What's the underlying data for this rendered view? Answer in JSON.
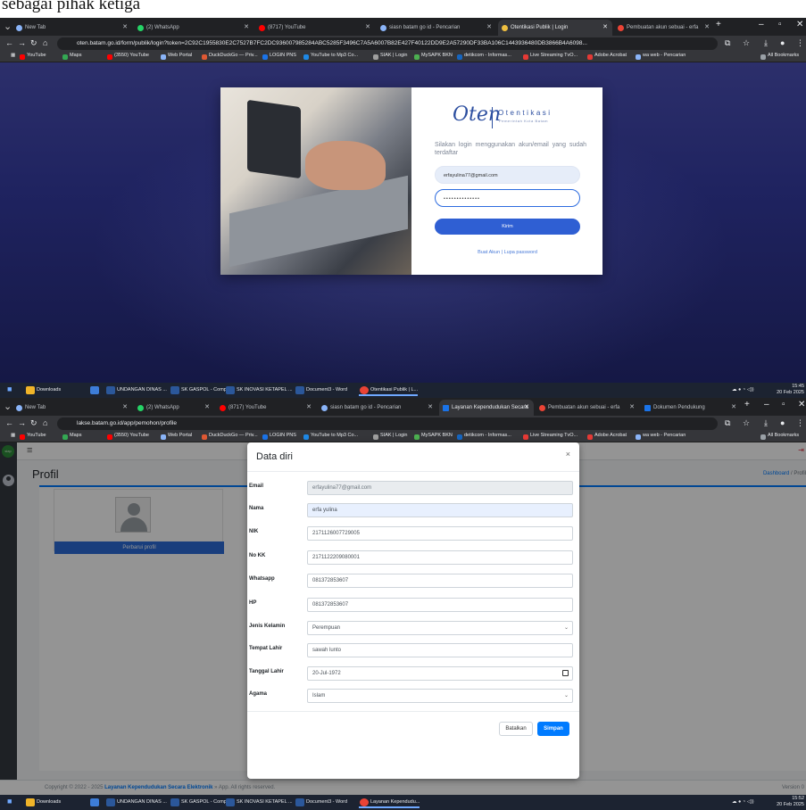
{
  "caption": "sebagai pihak ketiga",
  "shot1": {
    "tabs": [
      {
        "label": "New Tab",
        "color": "#8ab4f8"
      },
      {
        "label": "(2) WhatsApp",
        "color": "#25d366"
      },
      {
        "label": "(8717) YouTube",
        "color": "#ff0000"
      },
      {
        "label": "siasn batam go id - Pencarian",
        "color": "#8ab4f8"
      },
      {
        "label": "Otentikasi Publik | Login",
        "color": "#f0c040"
      },
      {
        "label": "Pembuatan akun sebuai - erfa",
        "color": "#ea4335"
      }
    ],
    "url": "oten.batam.go.id/form/publik/login?token=2C92C1955830E2C7527B7FC2DC936007985284ABC5285F3496C7A5A6007B82E427F40122DD9E2A57290DF33BA106C1443936480DB3866B4A6098...",
    "bookmarks": [
      {
        "label": "YouTube",
        "color": "#ff0000"
      },
      {
        "label": "Maps",
        "color": "#34a853"
      },
      {
        "label": "(3550) YouTube",
        "color": "#ff0000"
      },
      {
        "label": "Web Portal",
        "color": "#8ab4f8"
      },
      {
        "label": "DuckDuckGo — Priv...",
        "color": "#de5833"
      },
      {
        "label": "LOGIN PNS",
        "color": "#1a73e8"
      },
      {
        "label": "YouTube to Mp3 Co...",
        "color": "#1e88e5"
      },
      {
        "label": "SIAK | Login",
        "color": "#9e9e9e"
      },
      {
        "label": "MySAPK BKN",
        "color": "#4caf50"
      },
      {
        "label": "detikcom - Informas...",
        "color": "#1565c0"
      },
      {
        "label": "Live Streaming TvO...",
        "color": "#e53935"
      },
      {
        "label": "Adobe Acrobat",
        "color": "#e53935"
      },
      {
        "label": "wa web - Pencarian",
        "color": "#8ab4f8"
      }
    ],
    "all_bookmarks": "All Bookmarks",
    "login": {
      "logo_script": "Oten",
      "logo_text": "Otentikasi",
      "logo_sub": "Pemerintah Kota Batam",
      "info": "Silakan login menggunakan akun/email yang sudah terdaftar",
      "email": "erfayulina77@gmail.com",
      "password": "••••••••••••••",
      "submit": "Kirim",
      "links": "Buat Akun | Lupa password"
    },
    "taskbar": [
      {
        "label": "Downloads",
        "color": "#f0b429"
      },
      {
        "label": "",
        "color": "#3d7dd8"
      },
      {
        "label": "UNDANGAN DINAS ...",
        "color": "#2b579a"
      },
      {
        "label": "SK GASPOL - Comp...",
        "color": "#2b579a"
      },
      {
        "label": "SK INOVASI KETAPEL ...",
        "color": "#2b579a"
      },
      {
        "label": "Document3 - Word",
        "color": "#2b579a"
      },
      {
        "label": "Otentikasi Publik | L...",
        "color": "#ea4335"
      }
    ],
    "clock": {
      "time": "15:45",
      "date": "20 Feb 2025"
    }
  },
  "shot2": {
    "tabs": [
      {
        "label": "New Tab",
        "color": "#8ab4f8"
      },
      {
        "label": "(2) WhatsApp",
        "color": "#25d366"
      },
      {
        "label": "(8717) YouTube",
        "color": "#ff0000"
      },
      {
        "label": "siasn batam go id - Pencarian",
        "color": "#8ab4f8"
      },
      {
        "label": "Layanan Kependudukan Secara",
        "color": "#1a73e8"
      },
      {
        "label": "Pembuatan akun sebuai - erfa",
        "color": "#ea4335"
      },
      {
        "label": "Dokumen Pendukung",
        "color": "#1a73e8"
      }
    ],
    "url": "lakse.batam.go.id/app/pemohon/profile",
    "brand": "siap",
    "page_title": "Profil",
    "breadcrumb": {
      "home": "Dashboard",
      "sep": " / ",
      "current": "Profil"
    },
    "update_button": "Perbarui profil",
    "modal": {
      "title": "Data diri",
      "close": "×",
      "fields": [
        {
          "label": "Email",
          "value": "erfayulina77@gmail.com"
        },
        {
          "label": "Nama",
          "value": "erfa yulina"
        },
        {
          "label": "NIK",
          "value": "2171126007729005"
        },
        {
          "label": "No KK",
          "value": "2171122209080001"
        },
        {
          "label": "Whatsapp",
          "value": "081372853607"
        },
        {
          "label": "HP",
          "value": "081372853607"
        },
        {
          "label": "Jenis Kelamin",
          "value": "Perempuan"
        },
        {
          "label": "Tempat Lahir",
          "value": "sawah lunto"
        },
        {
          "label": "Tanggal Lahir",
          "value": "20-Jul-1972"
        },
        {
          "label": "Agama",
          "value": "Islam"
        }
      ],
      "cancel": "Batalkan",
      "save": "Simpan"
    },
    "footer": {
      "prefix": "Copyright © 2022 - 2025 ",
      "link": "Layanan Kependudukan Secara Elektronik",
      "suffix": " » App. All rights reserved.",
      "version": "Version 0"
    },
    "taskbar": [
      {
        "label": "Downloads",
        "color": "#f0b429"
      },
      {
        "label": "",
        "color": "#3d7dd8"
      },
      {
        "label": "UNDANGAN DINAS ...",
        "color": "#2b579a"
      },
      {
        "label": "SK GASPOL - Comp...",
        "color": "#2b579a"
      },
      {
        "label": "SK INOVASI KETAPEL ...",
        "color": "#2b579a"
      },
      {
        "label": "Document3 - Word",
        "color": "#2b579a"
      },
      {
        "label": "Layanan Kependudu...",
        "color": "#ea4335"
      }
    ],
    "clock": {
      "time": "15:52",
      "date": "20 Feb 2025"
    }
  }
}
